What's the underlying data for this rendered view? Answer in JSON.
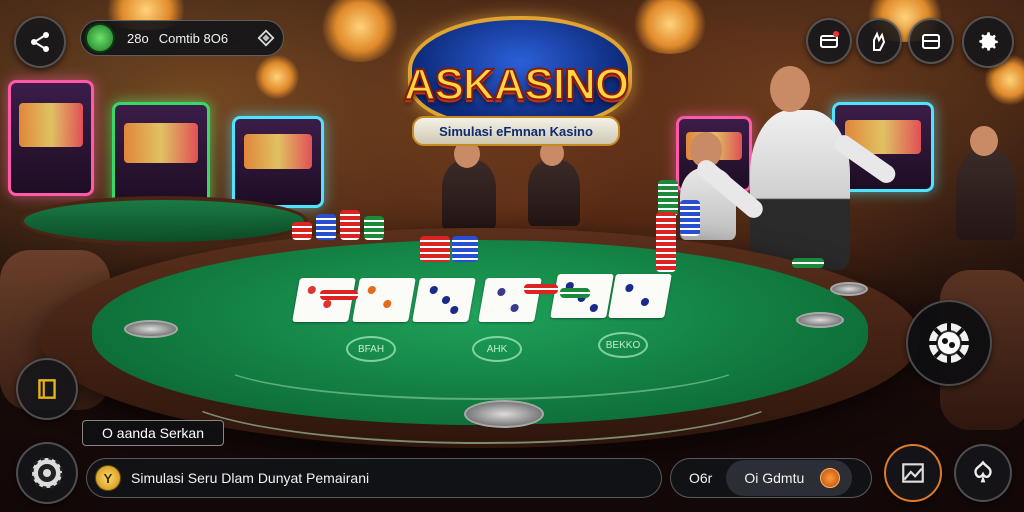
{
  "hud": {
    "balance_value": "28o",
    "player_name": "Comtib 8O6",
    "caption": "O aanda Serkan",
    "message": "Simulasi Seru Dlam Dunyat Pemairani",
    "info_value": "O6r",
    "action_label": "Oi Gdmtu"
  },
  "logo": {
    "title": "ASKASINO",
    "subtitle": "Simulasi eFmnan Kasino"
  },
  "table": {
    "felt_labels": [
      "BFAH",
      "AHK",
      "BEKKO"
    ]
  },
  "colors": {
    "felt": "#0d6e37",
    "rim": "#5a2f1c",
    "logo_gold": "#ffd640",
    "logo_blue": "#0d2a7a",
    "hud_dark": "#141618"
  },
  "icons": {
    "top_left": "share-icon",
    "top_right": [
      "gift-cards-icon",
      "hand-icon",
      "wallet-icon",
      "gear-icon"
    ],
    "left_side": "book-icon",
    "bottom_left": "chip-icon",
    "right_side": "poker-chip-icon",
    "bottom_right": [
      "image-icon",
      "cards-icon"
    ]
  }
}
